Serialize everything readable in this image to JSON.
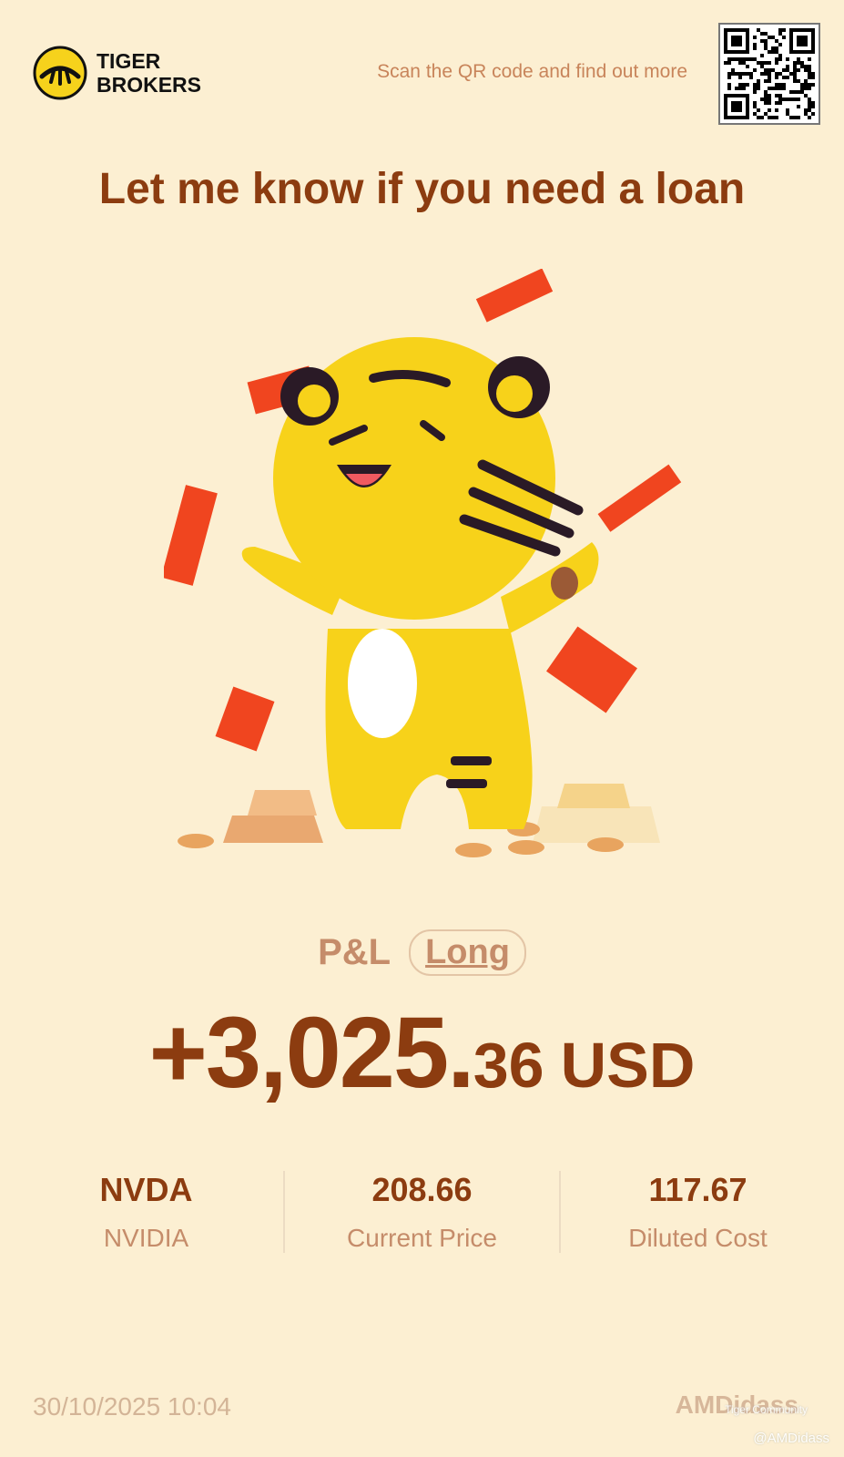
{
  "brand": {
    "line1": "TIGER",
    "line2": "BROKERS",
    "logo_icon": "tiger-stripes-logo-icon"
  },
  "header": {
    "scan_text": "Scan the QR code and find out more",
    "qr_icon": "qr-code-icon"
  },
  "headline": "Let me know if you need a loan",
  "hero": {
    "icon": "tiger-mascot-with-red-envelopes-and-gold-icon"
  },
  "pl": {
    "label": "P&L",
    "position_tag": "Long",
    "amount_integer": "+3,025.",
    "amount_decimal": "36",
    "currency": "USD"
  },
  "stats": [
    {
      "value": "NVDA",
      "label": "NVIDIA"
    },
    {
      "value": "208.66",
      "label": "Current Price"
    },
    {
      "value": "117.67",
      "label": "Diluted Cost"
    }
  ],
  "footer": {
    "datetime": "30/10/2025 10:04",
    "username": "AMDidass"
  },
  "watermark": {
    "site": "Tiger Community",
    "handle": "@AMDidass"
  },
  "colors": {
    "background": "#fcefd2",
    "accent_brown": "#8c3c10",
    "muted": "#c58c6a",
    "brand_yellow": "#f6d21c"
  }
}
